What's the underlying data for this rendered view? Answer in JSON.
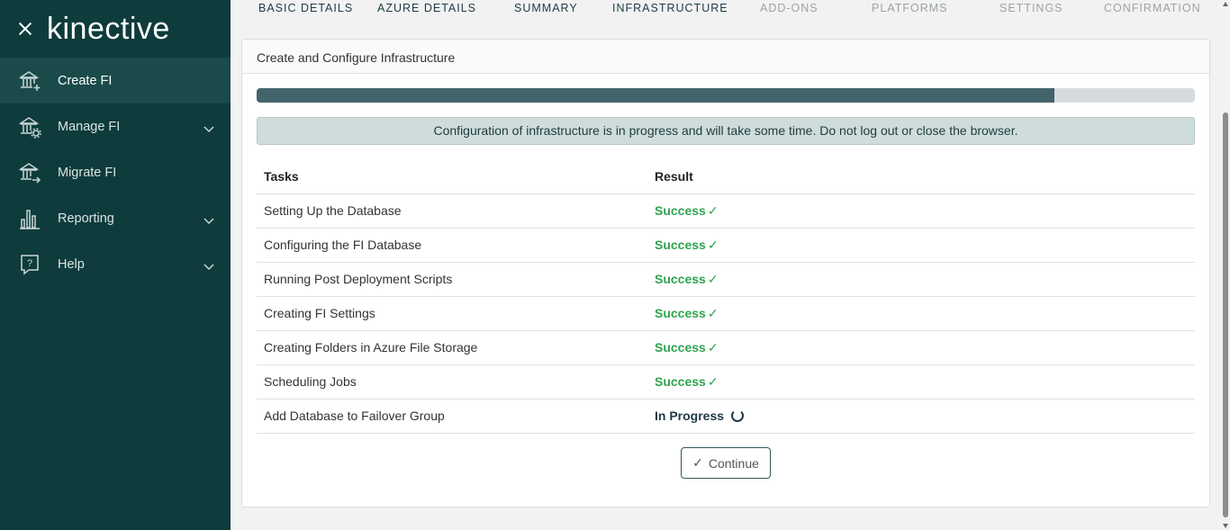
{
  "brand": {
    "logo": "kinective"
  },
  "sidebar": {
    "items": [
      {
        "label": "Create FI",
        "icon": "bank-plus-icon",
        "active": true,
        "expandable": false
      },
      {
        "label": "Manage FI",
        "icon": "bank-gear-icon",
        "active": false,
        "expandable": true
      },
      {
        "label": "Migrate FI",
        "icon": "bank-arrow-icon",
        "active": false,
        "expandable": false
      },
      {
        "label": "Reporting",
        "icon": "bar-chart-icon",
        "active": false,
        "expandable": true
      },
      {
        "label": "Help",
        "icon": "help-bubble-icon",
        "active": false,
        "expandable": true
      }
    ]
  },
  "steps": [
    {
      "label": "BASIC DETAILS",
      "state": "done"
    },
    {
      "label": "AZURE DETAILS",
      "state": "done"
    },
    {
      "label": "SUMMARY",
      "state": "done"
    },
    {
      "label": "INFRASTRUCTURE",
      "state": "current"
    },
    {
      "label": "ADD-ONS",
      "state": "future"
    },
    {
      "label": "PLATFORMS",
      "state": "future"
    },
    {
      "label": "SETTINGS",
      "state": "future"
    },
    {
      "label": "CONFIRMATION",
      "state": "future"
    }
  ],
  "card": {
    "title": "Create and Configure Infrastructure",
    "progress_fraction": 0.85,
    "alert": "Configuration of infrastructure is in progress and will take some time. Do not log out or close the browser.",
    "table": {
      "headers": [
        "Tasks",
        "Result"
      ],
      "rows": [
        {
          "task": "Setting Up the Database",
          "result": "Success",
          "status": "success"
        },
        {
          "task": "Configuring the FI Database",
          "result": "Success",
          "status": "success"
        },
        {
          "task": "Running Post Deployment Scripts",
          "result": "Success",
          "status": "success"
        },
        {
          "task": "Creating FI Settings",
          "result": "Success",
          "status": "success"
        },
        {
          "task": "Creating Folders in Azure File Storage",
          "result": "Success",
          "status": "success"
        },
        {
          "task": "Scheduling Jobs",
          "result": "Success",
          "status": "success"
        },
        {
          "task": "Add Database to Failover Group",
          "result": "In Progress",
          "status": "in-progress"
        }
      ]
    },
    "continue_label": "Continue"
  },
  "colors": {
    "sidebar": "#0e3b3b",
    "success": "#2ea44f",
    "progress": "#44646b",
    "alert_bg": "#cfdcdc"
  }
}
